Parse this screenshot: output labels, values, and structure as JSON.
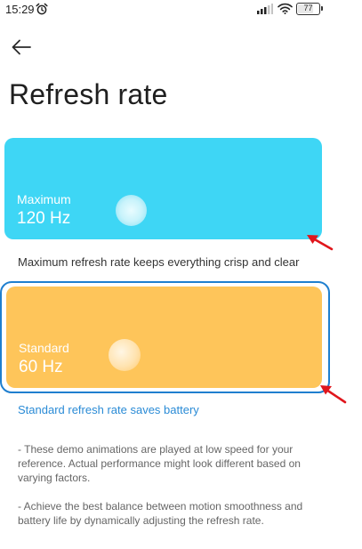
{
  "status_bar": {
    "time": "15:29",
    "battery_level": "77",
    "battery_percent": 77
  },
  "header": {
    "title": "Refresh rate"
  },
  "options": {
    "maximum": {
      "mode": "Maximum",
      "rate": "120 Hz",
      "description": "Maximum refresh rate keeps everything crisp and clear",
      "color": "#3ed6f5",
      "selected": false
    },
    "standard": {
      "mode": "Standard",
      "rate": "60 Hz",
      "description": "Standard refresh rate saves battery",
      "color": "#fec55a",
      "selected": true
    }
  },
  "notes": [
    "- These demo animations are played at low speed for your reference. Actual performance might look different based on varying factors.",
    "- Achieve the best balance between motion smoothness and battery life by dynamically adjusting the refresh rate."
  ],
  "colors": {
    "selection_ring": "#1f7fcf",
    "link_text": "#2a8bd6",
    "annotation_arrow": "#e0161c"
  },
  "icons": {
    "back": "arrow-left-icon",
    "alarm": "alarm-clock-icon",
    "signal": "cellular-signal-icon",
    "wifi": "wifi-icon",
    "battery": "battery-icon",
    "annotation": "red-pointer-arrow-icon"
  }
}
